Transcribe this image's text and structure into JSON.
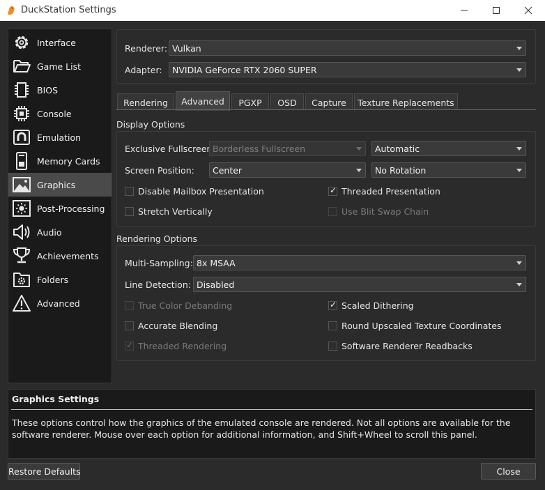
{
  "window": {
    "title": "DuckStation Settings"
  },
  "sidebar": {
    "items": [
      {
        "label": "Interface",
        "icon": "gear-icon"
      },
      {
        "label": "Game List",
        "icon": "folder-open-icon"
      },
      {
        "label": "BIOS",
        "icon": "chip-icon"
      },
      {
        "label": "Console",
        "icon": "cpu-icon"
      },
      {
        "label": "Emulation",
        "icon": "emulation-icon"
      },
      {
        "label": "Memory Cards",
        "icon": "memory-card-icon"
      },
      {
        "label": "Graphics",
        "icon": "image-icon"
      },
      {
        "label": "Post-Processing",
        "icon": "brightness-icon"
      },
      {
        "label": "Audio",
        "icon": "speaker-icon"
      },
      {
        "label": "Achievements",
        "icon": "trophy-icon"
      },
      {
        "label": "Folders",
        "icon": "folder-gear-icon"
      },
      {
        "label": "Advanced",
        "icon": "warning-icon"
      }
    ],
    "active": "Graphics"
  },
  "renderer": {
    "label": "Renderer:",
    "value": "Vulkan"
  },
  "adapter": {
    "label": "Adapter:",
    "value": "NVIDIA GeForce RTX 2060 SUPER"
  },
  "tabs": [
    "Rendering",
    "Advanced",
    "PGXP",
    "OSD",
    "Capture",
    "Texture Replacements"
  ],
  "active_tab": "Advanced",
  "display_options": {
    "title": "Display Options",
    "exclusive_fullscreen": {
      "label": "Exclusive Fullscreen:",
      "value": "Borderless Fullscreen",
      "mode": "Automatic"
    },
    "screen_position": {
      "label": "Screen Position:",
      "value": "Center",
      "rotation": "No Rotation"
    },
    "disable_mailbox": {
      "label": "Disable Mailbox Presentation",
      "checked": false
    },
    "threaded_presentation": {
      "label": "Threaded Presentation",
      "checked": true
    },
    "stretch_vertically": {
      "label": "Stretch Vertically",
      "checked": false
    },
    "use_blit_swap_chain": {
      "label": "Use Blit Swap Chain",
      "checked": false
    }
  },
  "rendering_options": {
    "title": "Rendering Options",
    "multi_sampling": {
      "label": "Multi-Sampling:",
      "value": "8x MSAA"
    },
    "line_detection": {
      "label": "Line Detection:",
      "value": "Disabled"
    },
    "true_color_debanding": {
      "label": "True Color Debanding",
      "checked": false
    },
    "scaled_dithering": {
      "label": "Scaled Dithering",
      "checked": true
    },
    "accurate_blending": {
      "label": "Accurate Blending",
      "checked": false
    },
    "round_upscaled": {
      "label": "Round Upscaled Texture Coordinates",
      "checked": false
    },
    "threaded_rendering": {
      "label": "Threaded Rendering",
      "checked": true
    },
    "software_readbacks": {
      "label": "Software Renderer Readbacks",
      "checked": false
    }
  },
  "help": {
    "title": "Graphics Settings",
    "body": "These options control how the graphics of the emulated console are rendered. Not all options are available for the software renderer. Mouse over each option for additional information, and Shift+Wheel to scroll this panel."
  },
  "buttons": {
    "restore_defaults": "Restore Defaults",
    "close": "Close"
  },
  "colors": {
    "background": "#2b2b2b",
    "panel": "#1a1a1a",
    "app_icon": "#f28c28"
  }
}
